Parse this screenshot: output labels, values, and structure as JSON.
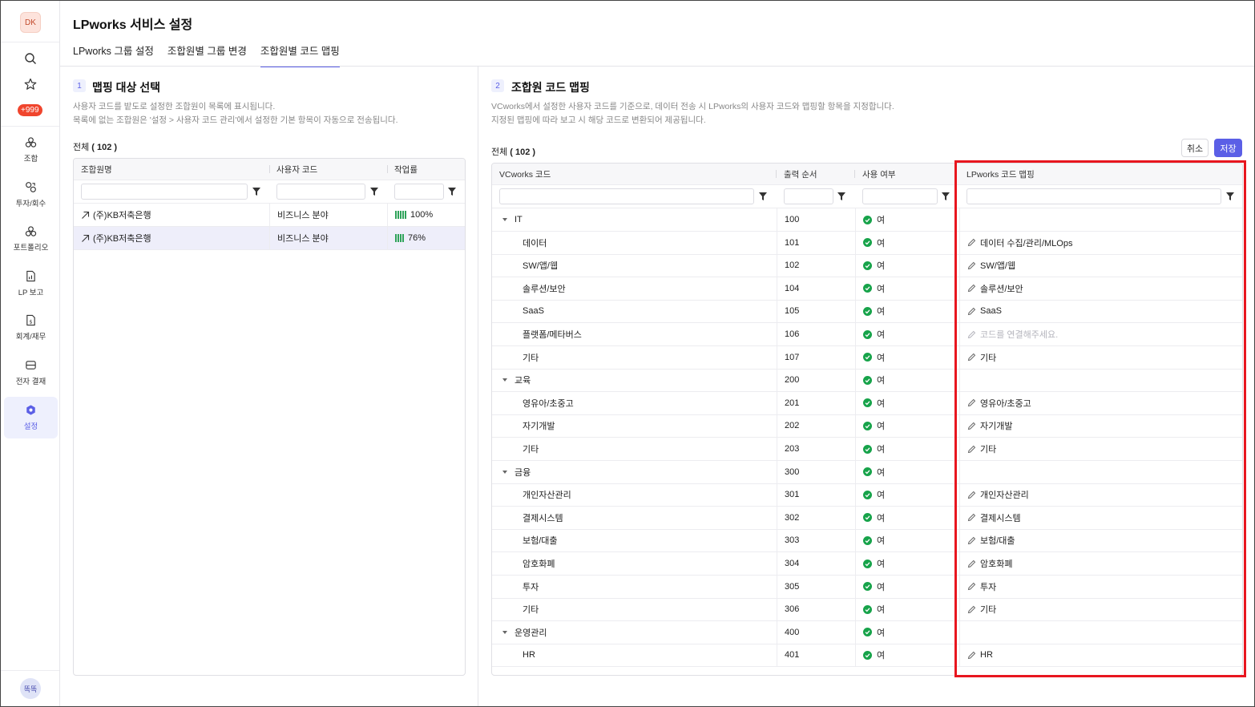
{
  "sidebar": {
    "avatar": "DK",
    "badge": "+999",
    "items": [
      {
        "label": "조합",
        "icon": "fund-icon"
      },
      {
        "label": "투자/회수",
        "icon": "investment-icon"
      },
      {
        "label": "포트폴리오",
        "icon": "portfolio-icon"
      },
      {
        "label": "LP 보고",
        "icon": "report-icon"
      },
      {
        "label": "회계/재무",
        "icon": "accounting-icon"
      },
      {
        "label": "전자 결재",
        "icon": "approval-icon"
      },
      {
        "label": "설정",
        "icon": "settings-icon",
        "active": true
      }
    ],
    "user_chip": "똑똑"
  },
  "header": {
    "title": "LPworks 서비스 설정",
    "tabs": [
      {
        "label": "LPworks 그룹 설정"
      },
      {
        "label": "조합원별 그룹 변경"
      },
      {
        "label": "조합원별 코드 맵핑",
        "active": true
      }
    ]
  },
  "left": {
    "num": "1",
    "title": "맵핑 대상 선택",
    "desc1": "사용자 코드를 밭도로 설정한 조합원이 목록에 표시됩니다.",
    "desc2": "목록에 없는 조합원은 '설정 > 사용자 코드 관리'에서 설정한 기본 항목이 자동으로 전송됩니다.",
    "count_prefix": "전체 ",
    "count_value": "( 102 )",
    "columns": [
      "조합원명",
      "사용자 코드",
      "작업률"
    ],
    "rows": [
      {
        "name": "(주)KB저축은행",
        "code": "비즈니스 분야",
        "rate": "100%",
        "bars": 5
      },
      {
        "name": "(주)KB저축은행",
        "code": "비즈니스 분야",
        "rate": "76%",
        "bars": 4,
        "selected": true
      }
    ]
  },
  "right": {
    "num": "2",
    "title": "조합원 코드 맵핑",
    "desc1": "VCworks에서 설정한 사용자 코드를 기준으로, 데이터 전송 시 LPworks의 사용자 코드와 맵핑할 항목을 지정합니다.",
    "desc2": "지정된 맵핑에 따라 보고 시 해당 코드로 변환되어 제공됩니다.",
    "count_prefix": "전체 ",
    "count_value": "( 102 )",
    "cancel_label": "취소",
    "save_label": "저장",
    "columns": [
      "VCworks 코드",
      "출력 순서",
      "사용 여부",
      "LPworks 코드 맵핑"
    ],
    "use_label": "여",
    "placeholder": "코드를 연결해주세요.",
    "rows": [
      {
        "code": "IT",
        "order": "100",
        "group": true,
        "mapping": ""
      },
      {
        "code": "데이터",
        "order": "101",
        "mapping": "데이터 수집/관리/MLOps"
      },
      {
        "code": "SW/앱/웹",
        "order": "102",
        "mapping": "SW/앱/웹"
      },
      {
        "code": "솔루션/보안",
        "order": "104",
        "mapping": "솔루션/보안"
      },
      {
        "code": "SaaS",
        "order": "105",
        "mapping": "SaaS"
      },
      {
        "code": "플랫폼/메타버스",
        "order": "106",
        "mapping": "",
        "empty": true
      },
      {
        "code": "기타",
        "order": "107",
        "mapping": "기타"
      },
      {
        "code": "교육",
        "order": "200",
        "group": true,
        "mapping": ""
      },
      {
        "code": "영유아/초중고",
        "order": "201",
        "mapping": "영유아/초중고"
      },
      {
        "code": "자기개발",
        "order": "202",
        "mapping": "자기개발"
      },
      {
        "code": "기타",
        "order": "203",
        "mapping": "기타"
      },
      {
        "code": "금융",
        "order": "300",
        "group": true,
        "mapping": ""
      },
      {
        "code": "개인자산관리",
        "order": "301",
        "mapping": "개인자산관리"
      },
      {
        "code": "결제시스템",
        "order": "302",
        "mapping": "결제시스템"
      },
      {
        "code": "보험/대출",
        "order": "303",
        "mapping": "보험/대출"
      },
      {
        "code": "암호화폐",
        "order": "304",
        "mapping": "암호화폐"
      },
      {
        "code": "투자",
        "order": "305",
        "mapping": "투자"
      },
      {
        "code": "기타",
        "order": "306",
        "mapping": "기타"
      },
      {
        "code": "운영관리",
        "order": "400",
        "group": true,
        "mapping": ""
      },
      {
        "code": "HR",
        "order": "401",
        "mapping": "HR"
      }
    ]
  }
}
